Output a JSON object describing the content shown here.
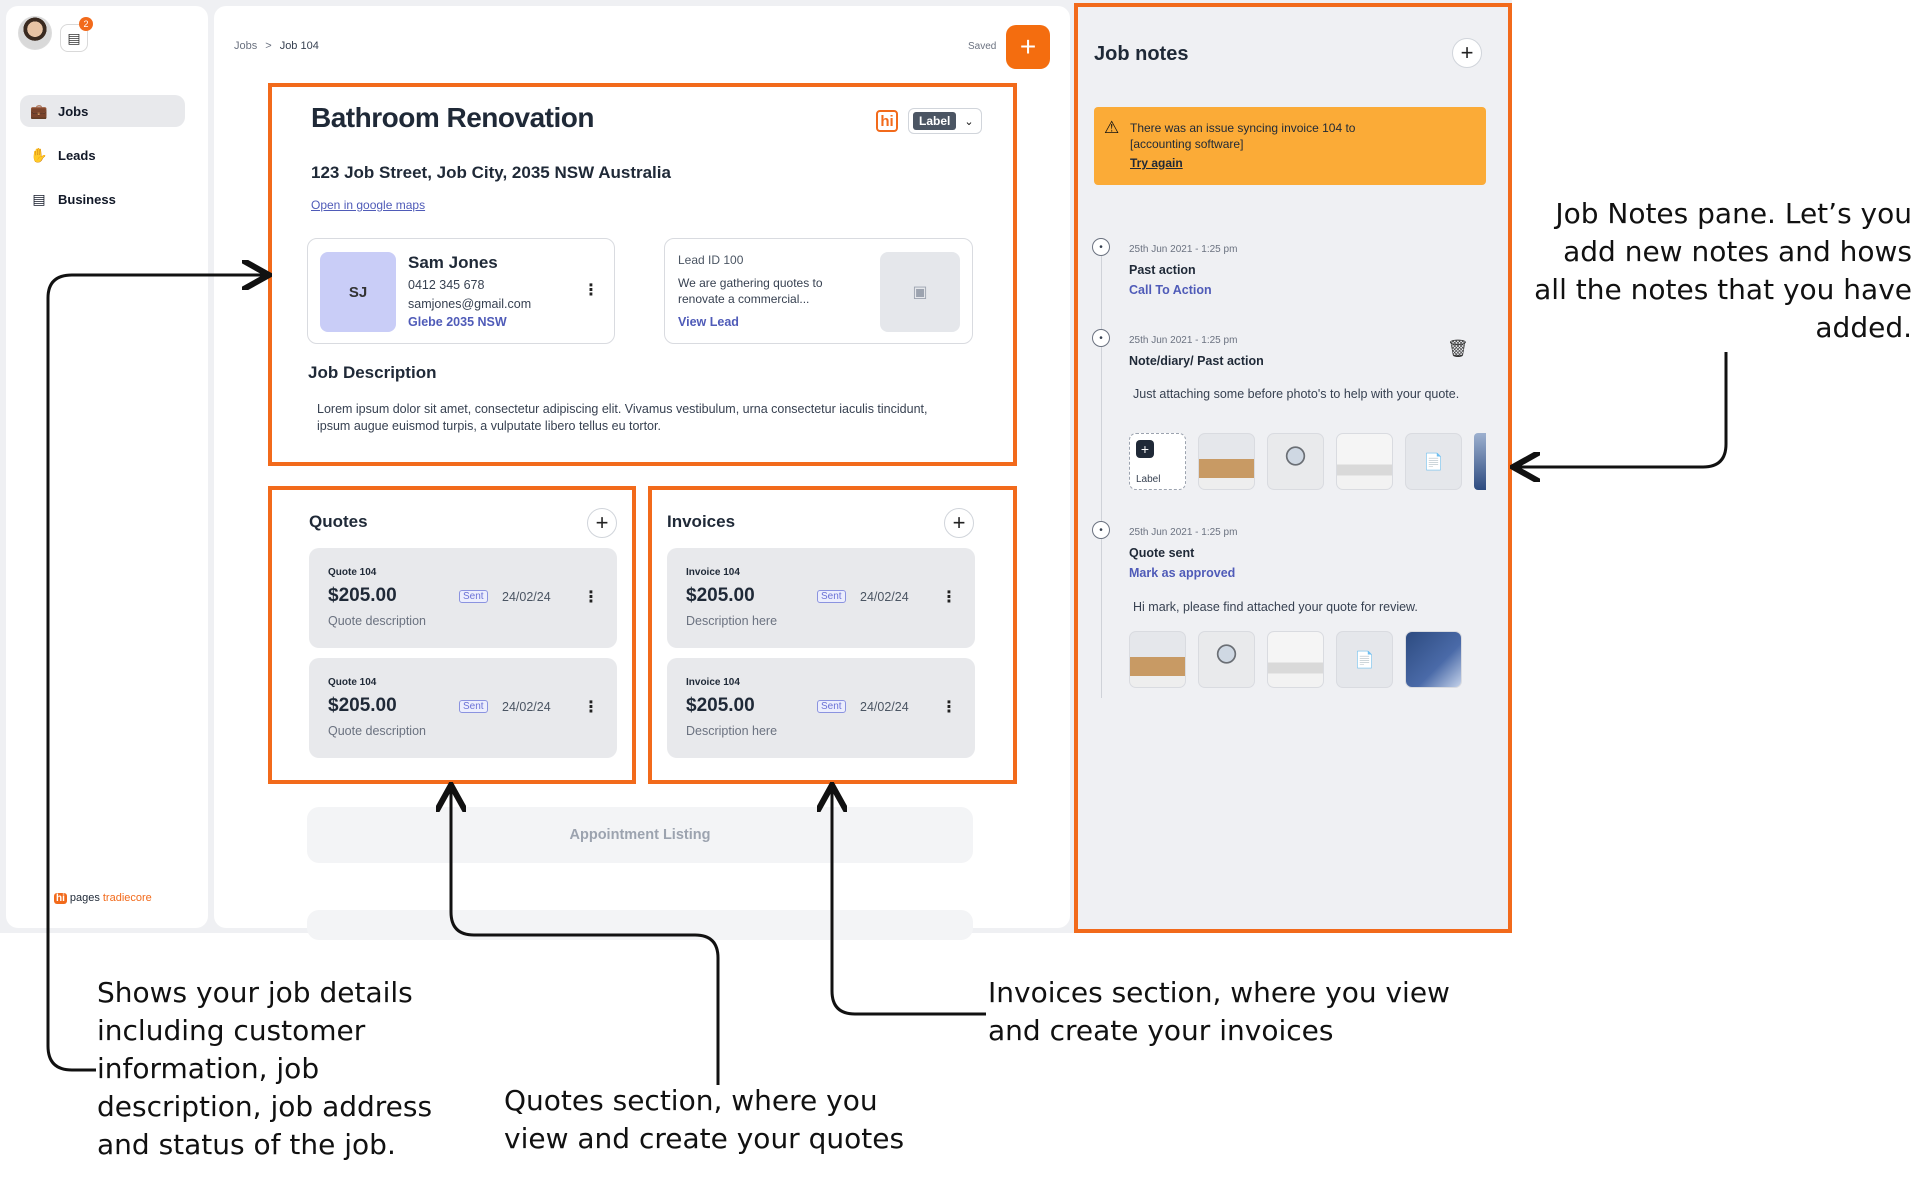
{
  "app": {
    "brand": {
      "hi": "hi",
      "pages": "pages",
      "tradiecore": "tradiecore"
    },
    "chat_badge": "2",
    "accent_color": "#f26a1b"
  },
  "sidebar": {
    "items": [
      {
        "label": "Jobs",
        "icon": "briefcase-icon",
        "active": true
      },
      {
        "label": "Leads",
        "icon": "hand-icon",
        "active": false
      },
      {
        "label": "Business",
        "icon": "bar-chart-icon",
        "active": false
      }
    ]
  },
  "header": {
    "breadcrumb": [
      "Jobs",
      "Job 104"
    ],
    "breadcrumb_separator": ">",
    "saved": "Saved",
    "add_button": "+"
  },
  "job": {
    "title": "Bathroom Renovation",
    "source_icon": "hi",
    "label": "Label",
    "address": "123 Job Street, Job City, 2035 NSW Australia",
    "maps_link": "Open in google maps",
    "customer": {
      "initials": "SJ",
      "name": "Sam Jones",
      "phone": "0412 345 678",
      "email": "samjones@gmail.com",
      "location": "Glebe 2035 NSW"
    },
    "lead": {
      "id": "Lead ID 100",
      "description": "We are gathering quotes to renovate a commercial...",
      "link": "View Lead"
    },
    "description_title": "Job Description",
    "description": "Lorem ipsum dolor sit amet, consectetur adipiscing elit. Vivamus vestibulum, urna consectetur iaculis tincidunt, ipsum augue euismod turpis, a vulputate libero tellus eu tortor."
  },
  "quotes": {
    "title": "Quotes",
    "items": [
      {
        "kind": "Quote 104",
        "amount": "$205.00",
        "description": "Quote description",
        "status": "Sent",
        "date": "24/02/24"
      },
      {
        "kind": "Quote 104",
        "amount": "$205.00",
        "description": "Quote description",
        "status": "Sent",
        "date": "24/02/24"
      }
    ]
  },
  "invoices": {
    "title": "Invoices",
    "items": [
      {
        "kind": "Invoice 104",
        "amount": "$205.00",
        "description": "Description here",
        "status": "Sent",
        "date": "24/02/24"
      },
      {
        "kind": "Invoice 104",
        "amount": "$205.00",
        "description": "Description here",
        "status": "Sent",
        "date": "24/02/24"
      }
    ]
  },
  "appointments": {
    "label": "Appointment Listing"
  },
  "notes": {
    "title": "Job notes",
    "alert": {
      "text": "There was an issue syncing invoice 104 to [accounting software]",
      "action": "Try again"
    },
    "entries": [
      {
        "date": "25th Jun 2021 - 1:25 pm",
        "title": "Past action",
        "link": "Call To  Action"
      },
      {
        "date": "25th Jun 2021 - 1:25 pm",
        "title": "Note/diary/ Past action",
        "text": "Just attaching some before photo's to help with your quote.",
        "add_label": "Label"
      },
      {
        "date": "25th Jun 2021 - 1:25 pm",
        "title": "Quote sent",
        "link": "Mark as approved",
        "text": "Hi mark, please find attached your quote for review."
      }
    ]
  },
  "annotations": {
    "notes": "Job Notes pane. Let’s you add new notes and hows all the notes that you have added.",
    "details": "Shows your job details including customer information, job description, job address and status of the job.",
    "quotes": "Quotes section, where you view and create your quotes",
    "invoices": "Invoices section, where you view and create your invoices"
  }
}
